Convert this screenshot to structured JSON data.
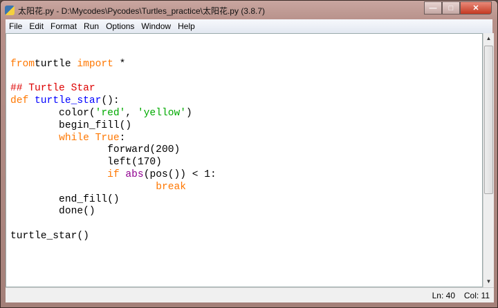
{
  "window": {
    "title": "太阳花.py - D:\\Mycodes\\Pycodes\\Turtles_practice\\太阳花.py (3.8.7)",
    "minimize": "—",
    "maximize": "□",
    "close": "✕"
  },
  "menu": [
    "File",
    "Edit",
    "Format",
    "Run",
    "Options",
    "Window",
    "Help"
  ],
  "code": [
    [],
    [
      [
        "kw",
        "from"
      ],
      [
        "",
        "turtle "
      ],
      [
        "kw",
        "import"
      ],
      [
        "",
        " *"
      ]
    ],
    [],
    [
      [
        "cm",
        "## Turtle Star"
      ]
    ],
    [
      [
        "kw",
        "def"
      ],
      [
        "",
        " "
      ],
      [
        "df",
        "turtle_star"
      ],
      [
        "",
        "():"
      ]
    ],
    [
      [
        "",
        "        color("
      ],
      [
        "st",
        "'red'"
      ],
      [
        "",
        ", "
      ],
      [
        "st",
        "'yellow'"
      ],
      [
        "",
        ")"
      ]
    ],
    [
      [
        "",
        "        begin_fill()"
      ]
    ],
    [
      [
        "",
        "        "
      ],
      [
        "kw",
        "while"
      ],
      [
        "",
        " "
      ],
      [
        "kw",
        "True"
      ],
      [
        "",
        ":"
      ]
    ],
    [
      [
        "",
        "                forward(200)"
      ]
    ],
    [
      [
        "",
        "                left(170)"
      ]
    ],
    [
      [
        "",
        "                "
      ],
      [
        "kw",
        "if"
      ],
      [
        "",
        " "
      ],
      [
        "bi",
        "abs"
      ],
      [
        "",
        "(pos()) < 1:"
      ]
    ],
    [
      [
        "",
        "                        "
      ],
      [
        "kw",
        "break"
      ]
    ],
    [
      [
        "",
        "        end_fill()"
      ]
    ],
    [
      [
        "",
        "        done()"
      ]
    ],
    [],
    [
      [
        "",
        "turtle_star()"
      ]
    ]
  ],
  "status": {
    "line": "Ln: 40",
    "col": "Col: 11"
  }
}
